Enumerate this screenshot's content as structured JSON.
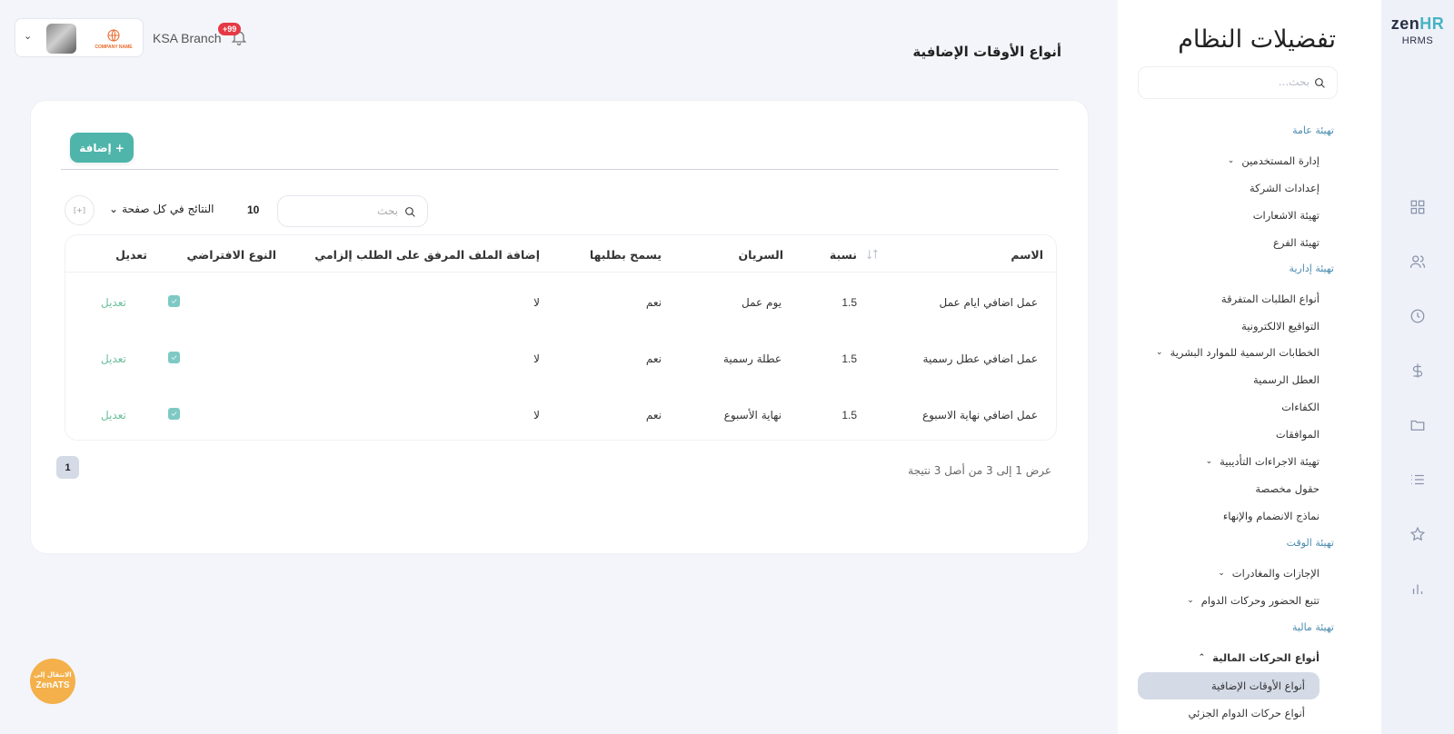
{
  "brand": {
    "zen": "zen",
    "hr": "HR",
    "subtitle": "HRMS"
  },
  "topbar": {
    "branch": "KSA Branch",
    "notification_count": "+99",
    "company_logo_text": "COMPANY NAME"
  },
  "settings": {
    "title": "تفضيلات النظام",
    "search_placeholder": "بحث...",
    "sections": {
      "general": "تهيئة عامة",
      "admin": "تهيئة إدارية",
      "time": "تهيئة الوقت",
      "finance": "تهيئة مالية"
    },
    "items": {
      "users": "إدارة المستخدمين",
      "company": "إعدادات الشركة",
      "notifications": "تهيئة الاشعارات",
      "branch": "تهيئة الفرع",
      "requests": "أنواع الطلبات المتفرقة",
      "esign": "التواقيع الالكترونية",
      "letters": "الخطابات الرسمية للموارد البشرية",
      "holidays": "العطل الرسمية",
      "competencies": "الكفاءات",
      "approvals": "الموافقات",
      "disciplinary": "تهيئة الاجراءات التأديبية",
      "custom_fields": "حقول مخصصة",
      "onboarding": "نماذج الانضمام والإنهاء",
      "leaves": "الإجازات والمغادرات",
      "attendance": "تتبع الحضور وحركات الدوام",
      "financial_types": "أنواع الحركات المالية",
      "overtime": "أنواع الأوقات الإضافية",
      "partial": "أنواع حركات الدوام الجزئي"
    }
  },
  "main": {
    "page_title": "أنواع الأوقات الإضافية",
    "add_button": "+ إضافة",
    "search_placeholder": "بحث",
    "per_page_label": "النتائج في كل صفحة",
    "per_page_value": "10",
    "columns": {
      "name": "الاسم",
      "rate": "نسبة",
      "applies": "السريان",
      "allow_request": "يسمح بطلبها",
      "attachment": "إضافة الملف المرفق على الطلب إلزامي",
      "default": "النوع الافتراضي",
      "edit": "تعديل"
    },
    "rows": [
      {
        "name": "عمل اضافي ايام عمل",
        "rate": "1.5",
        "applies": "يوم عمل",
        "allow_request": "نعم",
        "attachment": "لا",
        "default": true,
        "edit": "تعديل"
      },
      {
        "name": "عمل اضافي عطل رسمية",
        "rate": "1.5",
        "applies": "عطلة رسمية",
        "allow_request": "نعم",
        "attachment": "لا",
        "default": true,
        "edit": "تعديل"
      },
      {
        "name": "عمل اضافي نهاية الاسبوع",
        "rate": "1.5",
        "applies": "نهاية الأسبوع",
        "allow_request": "نعم",
        "attachment": "لا",
        "default": true,
        "edit": "تعديل"
      }
    ],
    "pagination": {
      "current_page": "1",
      "summary": "عرض 1 إلى 3 من أصل 3 نتيجة"
    }
  },
  "ats_button": {
    "line1": "الانتقال إلى",
    "line2": "ZenATS"
  },
  "colors": {
    "accent": "#4fb5aa",
    "brand_hr": "#46b3c4",
    "badge": "#e53945",
    "ats": "#f4b04a"
  }
}
